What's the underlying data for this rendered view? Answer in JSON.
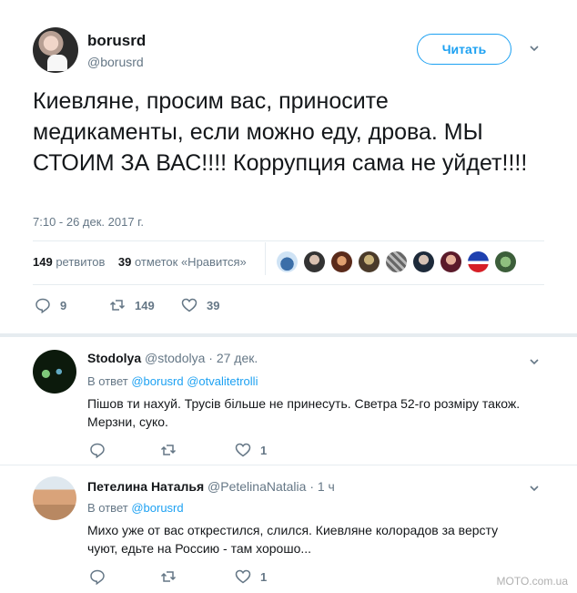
{
  "tweet": {
    "display_name": "borusrd",
    "handle": "@borusrd",
    "follow_label": "Читать",
    "text": "Киевляне, просим вас, приносите медикаменты, если можно еду, дрова. МЫ СТОИМ ЗА ВАС!!!! Коррупция сама не уйдет!!!!",
    "timestamp": "7:10 - 26 дек. 2017 г.",
    "retweets_count": "149",
    "retweets_label": "ретвитов",
    "likes_count": "39",
    "likes_label": "отметок «Нравится»",
    "actions": {
      "replies": "9",
      "retweets": "149",
      "likes": "39"
    }
  },
  "replies": [
    {
      "name": "Stodolya",
      "handle": "@stodolya",
      "date": "· 27 дек.",
      "in_reply_prefix": "В ответ",
      "in_reply_to": [
        "@borusrd",
        "@otvalitetrolli"
      ],
      "text": "Пішов ти нахуй. Трусів більше не принесуть. Светра 52-го розміру також. Мерзни, суко.",
      "likes": "1"
    },
    {
      "name": "Петелина Наталья",
      "handle": "@PetelinaNatalia",
      "date": "· 1 ч",
      "in_reply_prefix": "В ответ",
      "in_reply_to": [
        "@borusrd"
      ],
      "text": "Михо уже от вас открестился, слился. Киевляне колорадов за версту чуют, едьте на Россию - там хорошо...",
      "likes": "1"
    }
  ],
  "watermark": "MOTO.com.ua",
  "colors": {
    "accent": "#1da1f2",
    "muted": "#657786",
    "text": "#14171a",
    "border": "#e6ecf0"
  }
}
